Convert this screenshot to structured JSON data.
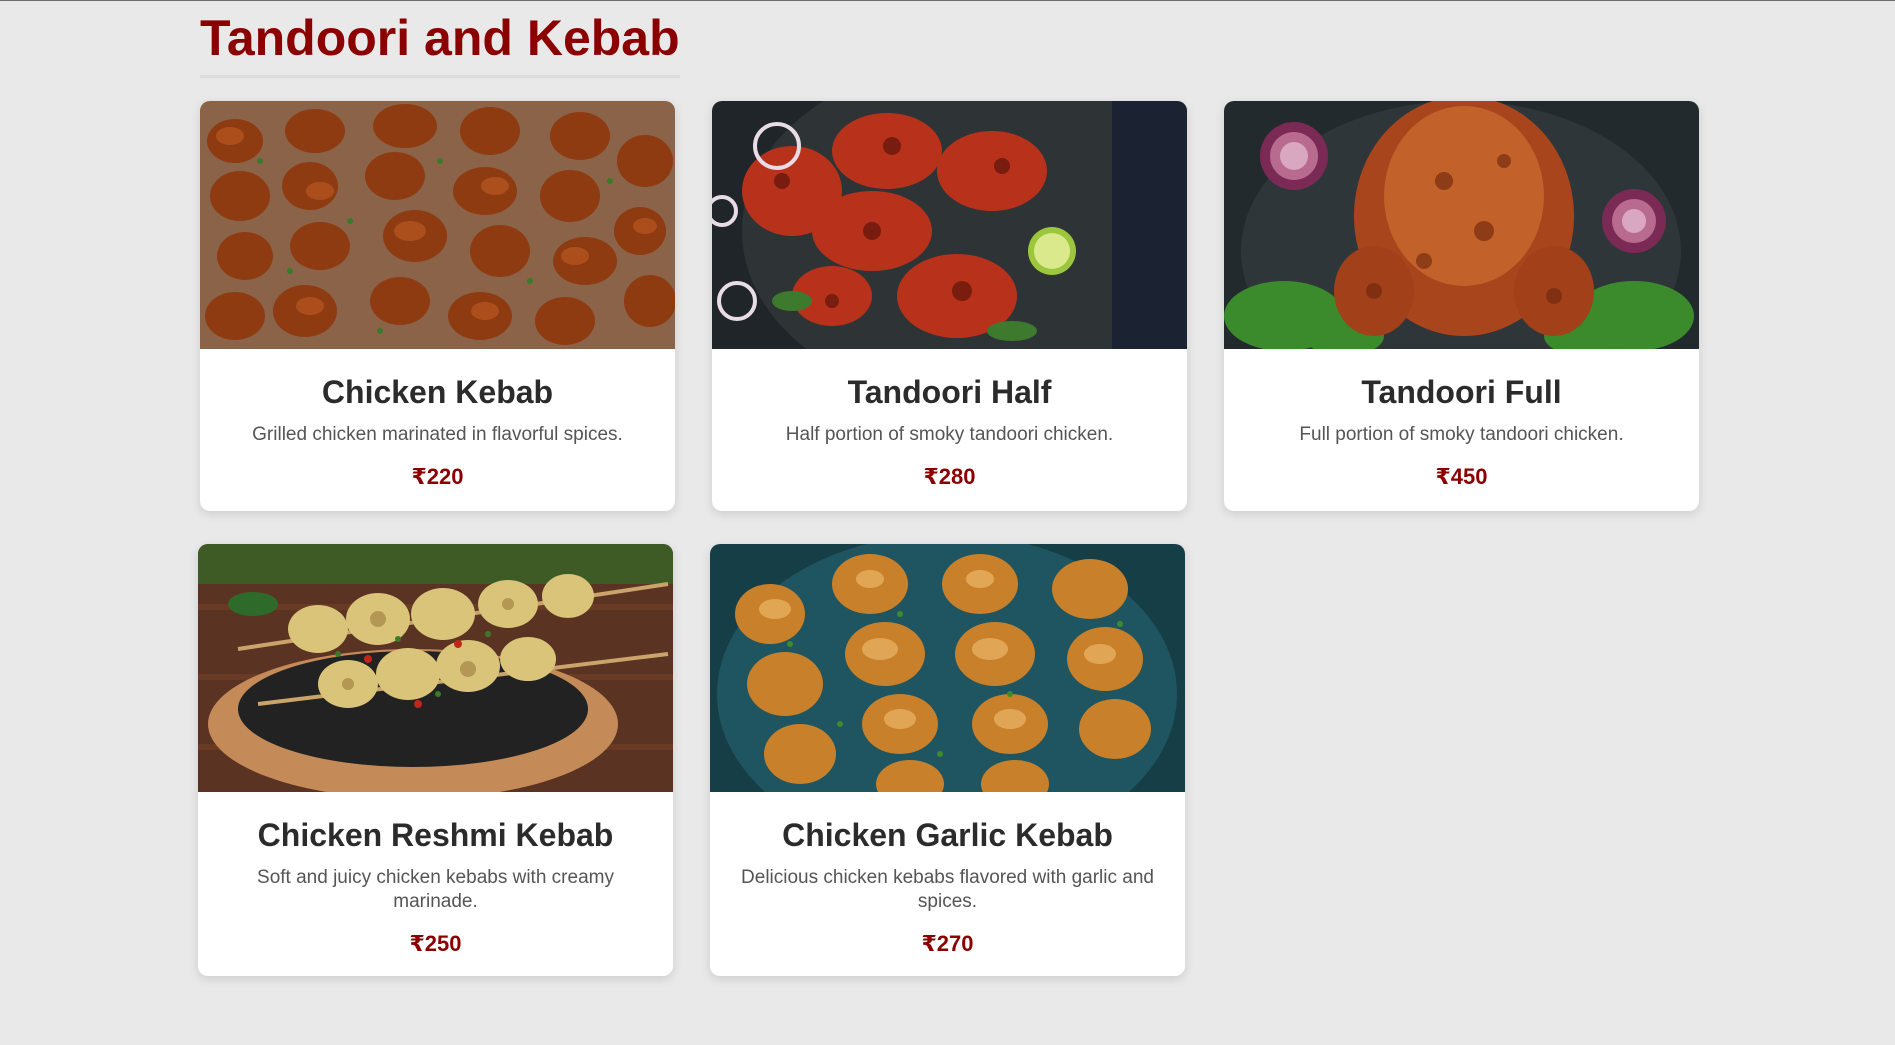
{
  "section": {
    "title": "Tandoori and Kebab"
  },
  "items": [
    {
      "name": "Chicken Kebab",
      "description": "Grilled chicken marinated in flavorful spices.",
      "price": "₹220",
      "image_icon": "chicken-kebab-photo"
    },
    {
      "name": "Tandoori Half",
      "description": "Half portion of smoky tandoori chicken.",
      "price": "₹280",
      "image_icon": "tandoori-half-photo"
    },
    {
      "name": "Tandoori Full",
      "description": "Full portion of smoky tandoori chicken.",
      "price": "₹450",
      "image_icon": "tandoori-full-photo"
    },
    {
      "name": "Chicken Reshmi Kebab",
      "description": "Soft and juicy chicken kebabs with creamy marinade.",
      "price": "₹250",
      "image_icon": "reshmi-kebab-photo"
    },
    {
      "name": "Chicken Garlic Kebab",
      "description": "Delicious chicken kebabs flavored with garlic and spices.",
      "price": "₹270",
      "image_icon": "garlic-kebab-photo"
    }
  ],
  "colors": {
    "accent": "#8b0000",
    "background": "#e9e9e9",
    "card": "#ffffff",
    "title_text": "#2b2b2b",
    "body_text": "#555555"
  }
}
